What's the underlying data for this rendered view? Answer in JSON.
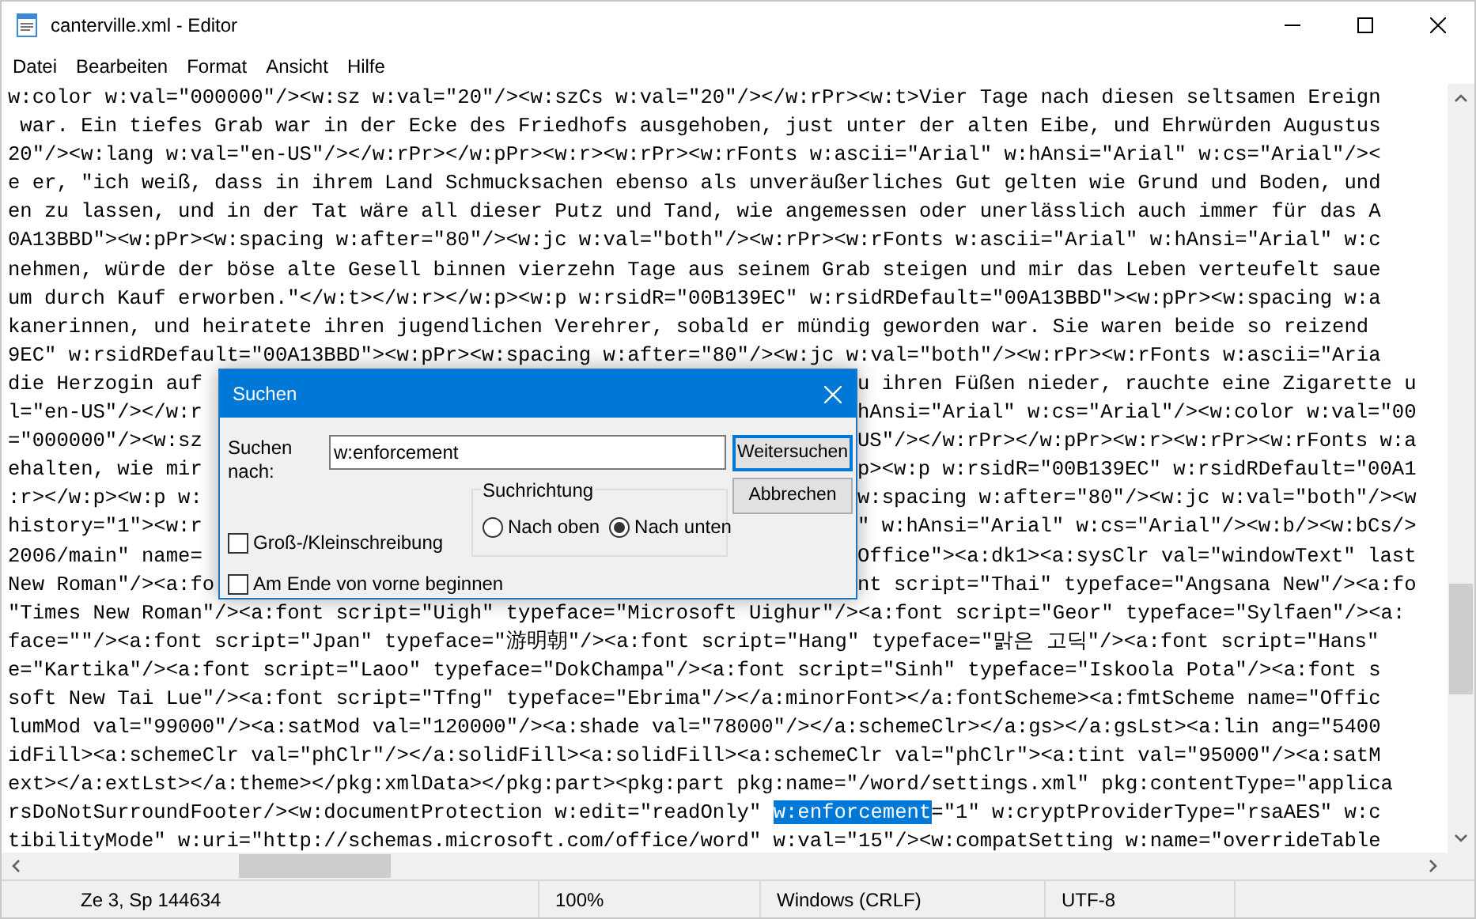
{
  "window": {
    "title": "canterville.xml - Editor"
  },
  "menu": [
    "Datei",
    "Bearbeiten",
    "Format",
    "Ansicht",
    "Hilfe"
  ],
  "editor": {
    "lines": [
      {
        "kind": "full",
        "text": "w:color w:val=\"000000\"/><w:sz w:val=\"20\"/><w:szCs w:val=\"20\"/></w:rPr><w:t>Vier Tage nach diesen seltsamen Ereign"
      },
      {
        "kind": "full",
        "text": " war. Ein tiefes Grab war in der Ecke des Friedhofs ausgehoben, just unter der alten Eibe, und Ehrwürden Augustus"
      },
      {
        "kind": "full",
        "text": "20\"/><w:lang w:val=\"en-US\"/></w:rPr></w:pPr><w:r><w:rPr><w:rFonts w:ascii=\"Arial\" w:hAnsi=\"Arial\" w:cs=\"Arial\"/><"
      },
      {
        "kind": "full",
        "text": "e er, \"ich weiß, dass in ihrem Land Schmucksachen ebenso als unveräußerliches Gut gelten wie Grund und Boden, und"
      },
      {
        "kind": "full",
        "text": "en zu lassen, und in der Tat wäre all dieser Putz und Tand, wie angemessen oder unerlässlich auch immer für das A"
      },
      {
        "kind": "full",
        "text": "0A13BBD\"><w:pPr><w:spacing w:after=\"80\"/><w:jc w:val=\"both\"/><w:rPr><w:rFonts w:ascii=\"Arial\" w:hAnsi=\"Arial\" w:c"
      },
      {
        "kind": "full",
        "text": "nehmen, würde der böse alte Gesell binnen vierzehn Tage aus seinem Grab steigen und mir das Leben verteufelt saue"
      },
      {
        "kind": "full",
        "text": "um durch Kauf erworben.\"</w:t></w:r></w:p><w:p w:rsidR=\"00B139EC\" w:rsidRDefault=\"00A13BBD\"><w:pPr><w:spacing w:a"
      },
      {
        "kind": "full",
        "text": "kanerinnen, und heiratete ihren jugendlichen Verehrer, sobald er mündig geworden war. Sie waren beide so reizend"
      },
      {
        "kind": "full",
        "text": "9EC\" w:rsidRDefault=\"00A13BBD\"><w:pPr><w:spacing w:after=\"80\"/><w:jc w:val=\"both\"/><w:rPr><w:rFonts w:ascii=\"Aria"
      },
      {
        "kind": "split",
        "left": "die Herzogin auf",
        "right": "u ihren Füßen nieder, rauchte eine Zigarette u"
      },
      {
        "kind": "split",
        "left": "l=\"en-US\"/></w:r",
        "right": "hAnsi=\"Arial\" w:cs=\"Arial\"/><w:color w:val=\"00"
      },
      {
        "kind": "split",
        "left": "=\"000000\"/><w:sz",
        "right": "US\"/></w:rPr></w:pPr><w:r><w:rPr><w:rFonts w:a"
      },
      {
        "kind": "split",
        "left": "ehalten, wie mir",
        "right": "p><w:p w:rsidR=\"00B139EC\" w:rsidRDefault=\"00A1"
      },
      {
        "kind": "split",
        "left": ":r></w:p><w:p w:",
        "right": "w:spacing w:after=\"80\"/><w:jc w:val=\"both\"/><w"
      },
      {
        "kind": "split",
        "left": "history=\"1\"><w:r",
        "right": "\" w:hAnsi=\"Arial\" w:cs=\"Arial\"/><w:b/><w:bCs/>"
      },
      {
        "kind": "split",
        "left": "2006/main\" name=",
        "right": "Office\"><a:dk1><a:sysClr val=\"windowText\" last"
      },
      {
        "kind": "split",
        "left": "New Roman\"/><a:fo",
        "right": "nt script=\"Thai\" typeface=\"Angsana New\"/><a:fo"
      },
      {
        "kind": "full",
        "text": "\"Times New Roman\"/><a:font script=\"Uigh\" typeface=\"Microsoft Uighur\"/><a:font script=\"Geor\" typeface=\"Sylfaen\"/><a:"
      },
      {
        "kind": "full",
        "text": "face=\"\"/><a:font script=\"Jpan\" typeface=\"游明朝\"/><a:font script=\"Hang\" typeface=\"맑은 고딕\"/><a:font script=\"Hans\""
      },
      {
        "kind": "full",
        "text": "e=\"Kartika\"/><a:font script=\"Laoo\" typeface=\"DokChampa\"/><a:font script=\"Sinh\" typeface=\"Iskoola Pota\"/><a:font s"
      },
      {
        "kind": "full",
        "text": "soft New Tai Lue\"/><a:font script=\"Tfng\" typeface=\"Ebrima\"/></a:minorFont></a:fontScheme><a:fmtScheme name=\"Offic"
      },
      {
        "kind": "full",
        "text": "lumMod val=\"99000\"/><a:satMod val=\"120000\"/><a:shade val=\"78000\"/></a:schemeClr></a:gs></a:gsLst><a:lin ang=\"5400"
      },
      {
        "kind": "full",
        "text": "idFill><a:schemeClr val=\"phClr\"/></a:solidFill><a:solidFill><a:schemeClr val=\"phClr\"><a:tint val=\"95000\"/><a:satM"
      },
      {
        "kind": "full",
        "text": "ext></a:extLst></a:theme></pkg:xmlData></pkg:part><pkg:part pkg:name=\"/word/settings.xml\" pkg:contentType=\"applica"
      },
      {
        "kind": "segments",
        "segments": [
          {
            "text": "rsDoNotSurroundFooter/><w:documentProtection w:edit=\"readOnly\" ",
            "selected": false
          },
          {
            "text": "w:enforcement",
            "selected": true
          },
          {
            "text": "=\"1\" w:cryptProviderType=\"rsaAES\" w:c",
            "selected": false
          }
        ]
      },
      {
        "kind": "full",
        "text": "tibilityMode\" w:uri=\"http://schemas.microsoft.com/office/word\" w:val=\"15\"/><w:compatSetting w:name=\"overrideTable"
      }
    ]
  },
  "dialog": {
    "title": "Suchen",
    "label": "Suchen nach:",
    "value": "w:enforcement",
    "buttons": [
      {
        "label": "Weitersuchen",
        "default": true
      },
      {
        "label": "Abbrechen",
        "default": false
      }
    ],
    "direction": {
      "title": "Suchrichtung",
      "options": [
        {
          "label": "Nach oben",
          "selected": false
        },
        {
          "label": "Nach unten",
          "selected": true
        }
      ]
    },
    "checkboxes": [
      {
        "label": "Groß-/Kleinschreibung",
        "checked": false
      },
      {
        "label": "Am Ende von vorne beginnen",
        "checked": false
      }
    ]
  },
  "status_bar": [
    "Ze 3, Sp 144634",
    "100%",
    "Windows (CRLF)",
    "UTF-8"
  ]
}
